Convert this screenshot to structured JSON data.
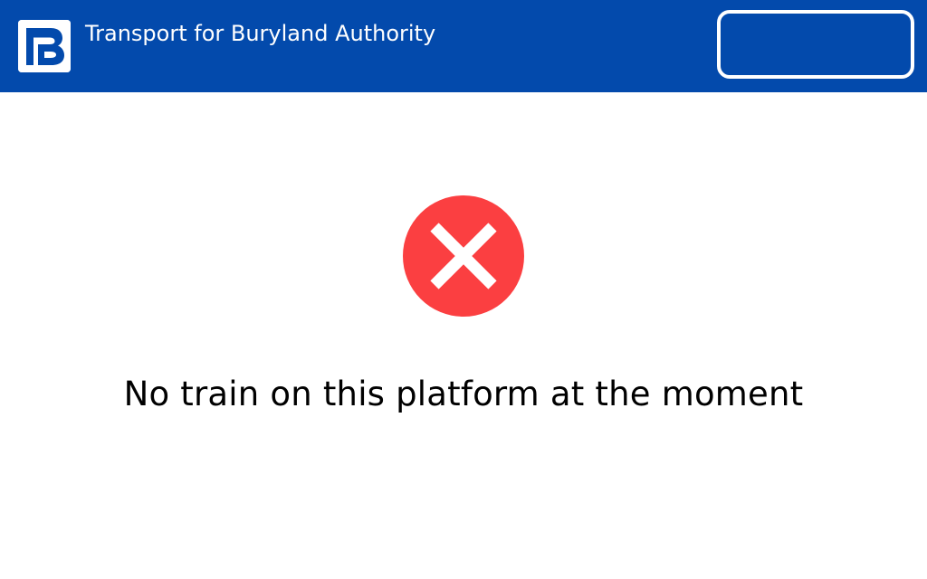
{
  "header": {
    "title": "Transport for Buryland Authority",
    "logo_icon": "tba-logo-icon",
    "background_color": "#034aac"
  },
  "status": {
    "icon": "error-x-icon",
    "icon_color": "#fb3f41",
    "message": "No train on this platform at the moment"
  }
}
